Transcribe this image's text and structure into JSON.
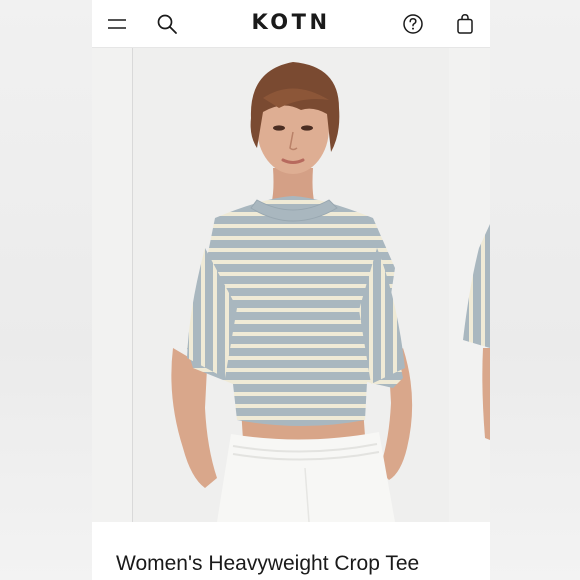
{
  "header": {
    "logo": "KOTN",
    "icons": [
      "hamburger-menu-icon",
      "search-icon",
      "help-icon",
      "shopping-bag-icon"
    ]
  },
  "product": {
    "title": "Women's Heavyweight Crop Tee"
  },
  "colors": {
    "stripe_blue": "#a9b7bf",
    "stripe_cream": "#efead6",
    "background": "#ececec"
  }
}
